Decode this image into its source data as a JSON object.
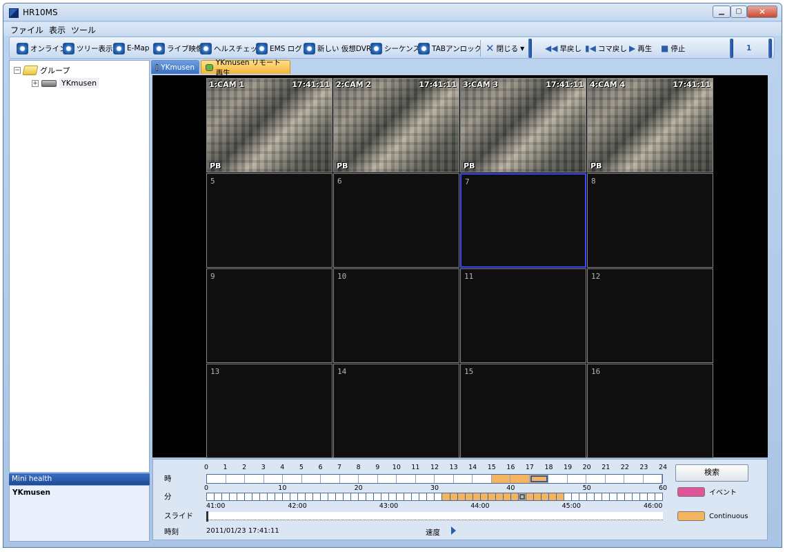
{
  "window": {
    "title": "HR10MS"
  },
  "menu": [
    "ファイル",
    "表示",
    "ツール"
  ],
  "toolbar": {
    "online": "オンライン",
    "tree": "ツリー表示",
    "emap": "E-Map",
    "live": "ライブ映像",
    "health": "ヘルスチェック",
    "emslog": "EMS ログ",
    "newdvr": "新しい 仮想DVR",
    "sequence": "シーケンス",
    "tabunlock": "TABアンロック",
    "close": "閉じる",
    "rewind": "早戻し",
    "stepback": "コマ戻し",
    "play": "再生",
    "stop": "停止",
    "extra": "1"
  },
  "tree": {
    "root": "グループ",
    "device": "YKmusen"
  },
  "mini_health": {
    "title": "Mini health",
    "device": "YKmusen"
  },
  "tabs": [
    "YKmusen",
    "YKmusen リモート再生"
  ],
  "cameras": [
    {
      "label": "1:CAM 1",
      "time": "17:41:11",
      "pb": "PB"
    },
    {
      "label": "2:CAM 2",
      "time": "17:41:11",
      "pb": "PB"
    },
    {
      "label": "3:CAM 3",
      "time": "17:41:11",
      "pb": "PB"
    },
    {
      "label": "4:CAM 4",
      "time": "17:41:11",
      "pb": "PB"
    }
  ],
  "empty_cells": [
    "5",
    "6",
    "7",
    "8",
    "9",
    "10",
    "11",
    "12",
    "13",
    "14",
    "15",
    "16"
  ],
  "timeline": {
    "hour_label": "時",
    "minute_label": "分",
    "slide_label": "スライド",
    "time_label": "時刻",
    "hours": [
      "0",
      "1",
      "2",
      "3",
      "4",
      "5",
      "6",
      "7",
      "8",
      "9",
      "10",
      "11",
      "12",
      "13",
      "14",
      "15",
      "16",
      "17",
      "18",
      "19",
      "20",
      "21",
      "22",
      "23",
      "24"
    ],
    "minutes": [
      "0",
      "10",
      "20",
      "30",
      "40",
      "50",
      "60"
    ],
    "slide_ticks": [
      "41:00",
      "42:00",
      "43:00",
      "44:00",
      "45:00",
      "46:00"
    ],
    "current_time": "2011/01/23 17:41:11",
    "speed_label": "速度",
    "recorded_hours": [
      15,
      16
    ],
    "current_hour": 17,
    "recorded_minutes_range": [
      31,
      46
    ],
    "current_minute": 41
  },
  "search": {
    "label": "検索"
  },
  "legend": [
    {
      "label": "イベント",
      "color": "#e0559a"
    },
    {
      "label": "Continuous",
      "color": "#f4b35e"
    }
  ]
}
